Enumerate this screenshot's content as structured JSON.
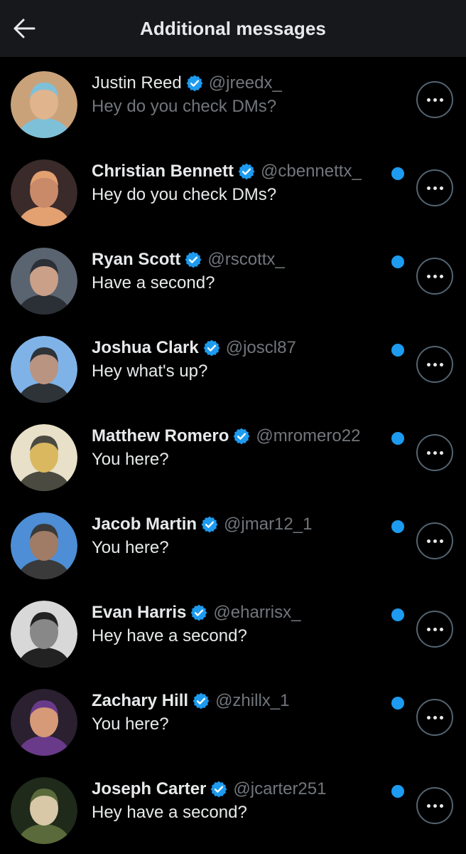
{
  "header": {
    "title": "Additional messages",
    "back_icon": "arrow-left-icon"
  },
  "colors": {
    "accent": "#1d9bf0",
    "secondary_text": "#71767b",
    "background": "#000000",
    "header_background": "#16181c"
  },
  "messages": [
    {
      "name": "Justin Reed",
      "handle": "@jreedx_",
      "preview": "Hey do you check DMs?",
      "unread": false,
      "verified": true,
      "avatar_colors": [
        "#c9a27a",
        "#e0b48c",
        "#7fc0d9"
      ]
    },
    {
      "name": "Christian Bennett",
      "handle": "@cbennettx_",
      "preview": "Hey do you check DMs?",
      "unread": true,
      "verified": true,
      "avatar_colors": [
        "#3a2a2a",
        "#c98a6a",
        "#e3a070"
      ]
    },
    {
      "name": "Ryan Scott",
      "handle": "@rscottx_",
      "preview": "Have a second?",
      "unread": true,
      "verified": true,
      "avatar_colors": [
        "#5a6470",
        "#caa088",
        "#2b3036"
      ]
    },
    {
      "name": "Joshua Clark",
      "handle": "@joscl87",
      "preview": "Hey what's up?",
      "unread": true,
      "verified": true,
      "avatar_colors": [
        "#7fb3e8",
        "#b99480",
        "#2e3338"
      ]
    },
    {
      "name": "Matthew Romero",
      "handle": "@mromero22",
      "preview": "You here?",
      "unread": true,
      "verified": true,
      "avatar_colors": [
        "#e8e0c8",
        "#d9b860",
        "#4a4a40"
      ]
    },
    {
      "name": "Jacob Martin",
      "handle": "@jmar12_1",
      "preview": "You here?",
      "unread": true,
      "verified": true,
      "avatar_colors": [
        "#4d8ed6",
        "#a07c66",
        "#3a3a3a"
      ]
    },
    {
      "name": "Evan Harris",
      "handle": "@eharrisx_",
      "preview": "Hey have a second?",
      "unread": true,
      "verified": true,
      "avatar_colors": [
        "#d8d8d8",
        "#888888",
        "#222222"
      ]
    },
    {
      "name": "Zachary Hill",
      "handle": "@zhillx_1",
      "preview": "You here?",
      "unread": true,
      "verified": true,
      "avatar_colors": [
        "#2a2030",
        "#d69a78",
        "#6a3a8a"
      ]
    },
    {
      "name": "Joseph Carter",
      "handle": "@jcarter251",
      "preview": "Hey have a second?",
      "unread": true,
      "verified": true,
      "avatar_colors": [
        "#1f2a1a",
        "#d8c8a8",
        "#5a6a3a"
      ]
    }
  ]
}
